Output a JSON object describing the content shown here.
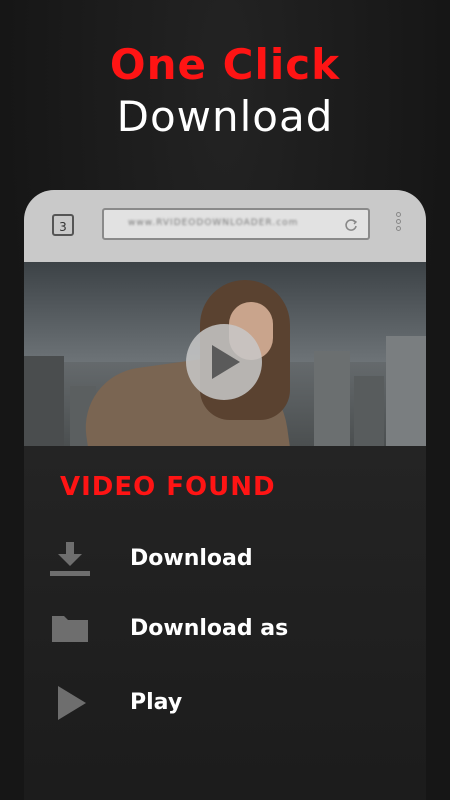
{
  "headline": {
    "line1": "One Click",
    "line2": "Download"
  },
  "browser": {
    "tab_count": "3",
    "url": "www.RVIDEODOWNLOADER.com"
  },
  "video": {
    "play_icon": "play-icon"
  },
  "found": {
    "title": "VIDEO FOUND",
    "actions": [
      {
        "label": "Download",
        "icon": "download-icon"
      },
      {
        "label": "Download as",
        "icon": "folder-icon"
      },
      {
        "label": "Play",
        "icon": "play-icon"
      }
    ]
  },
  "colors": {
    "accent_red": "#ff1414",
    "background": "#181818",
    "browser_bar": "#c9c9c9",
    "icon_gray": "#6e6e6e"
  }
}
